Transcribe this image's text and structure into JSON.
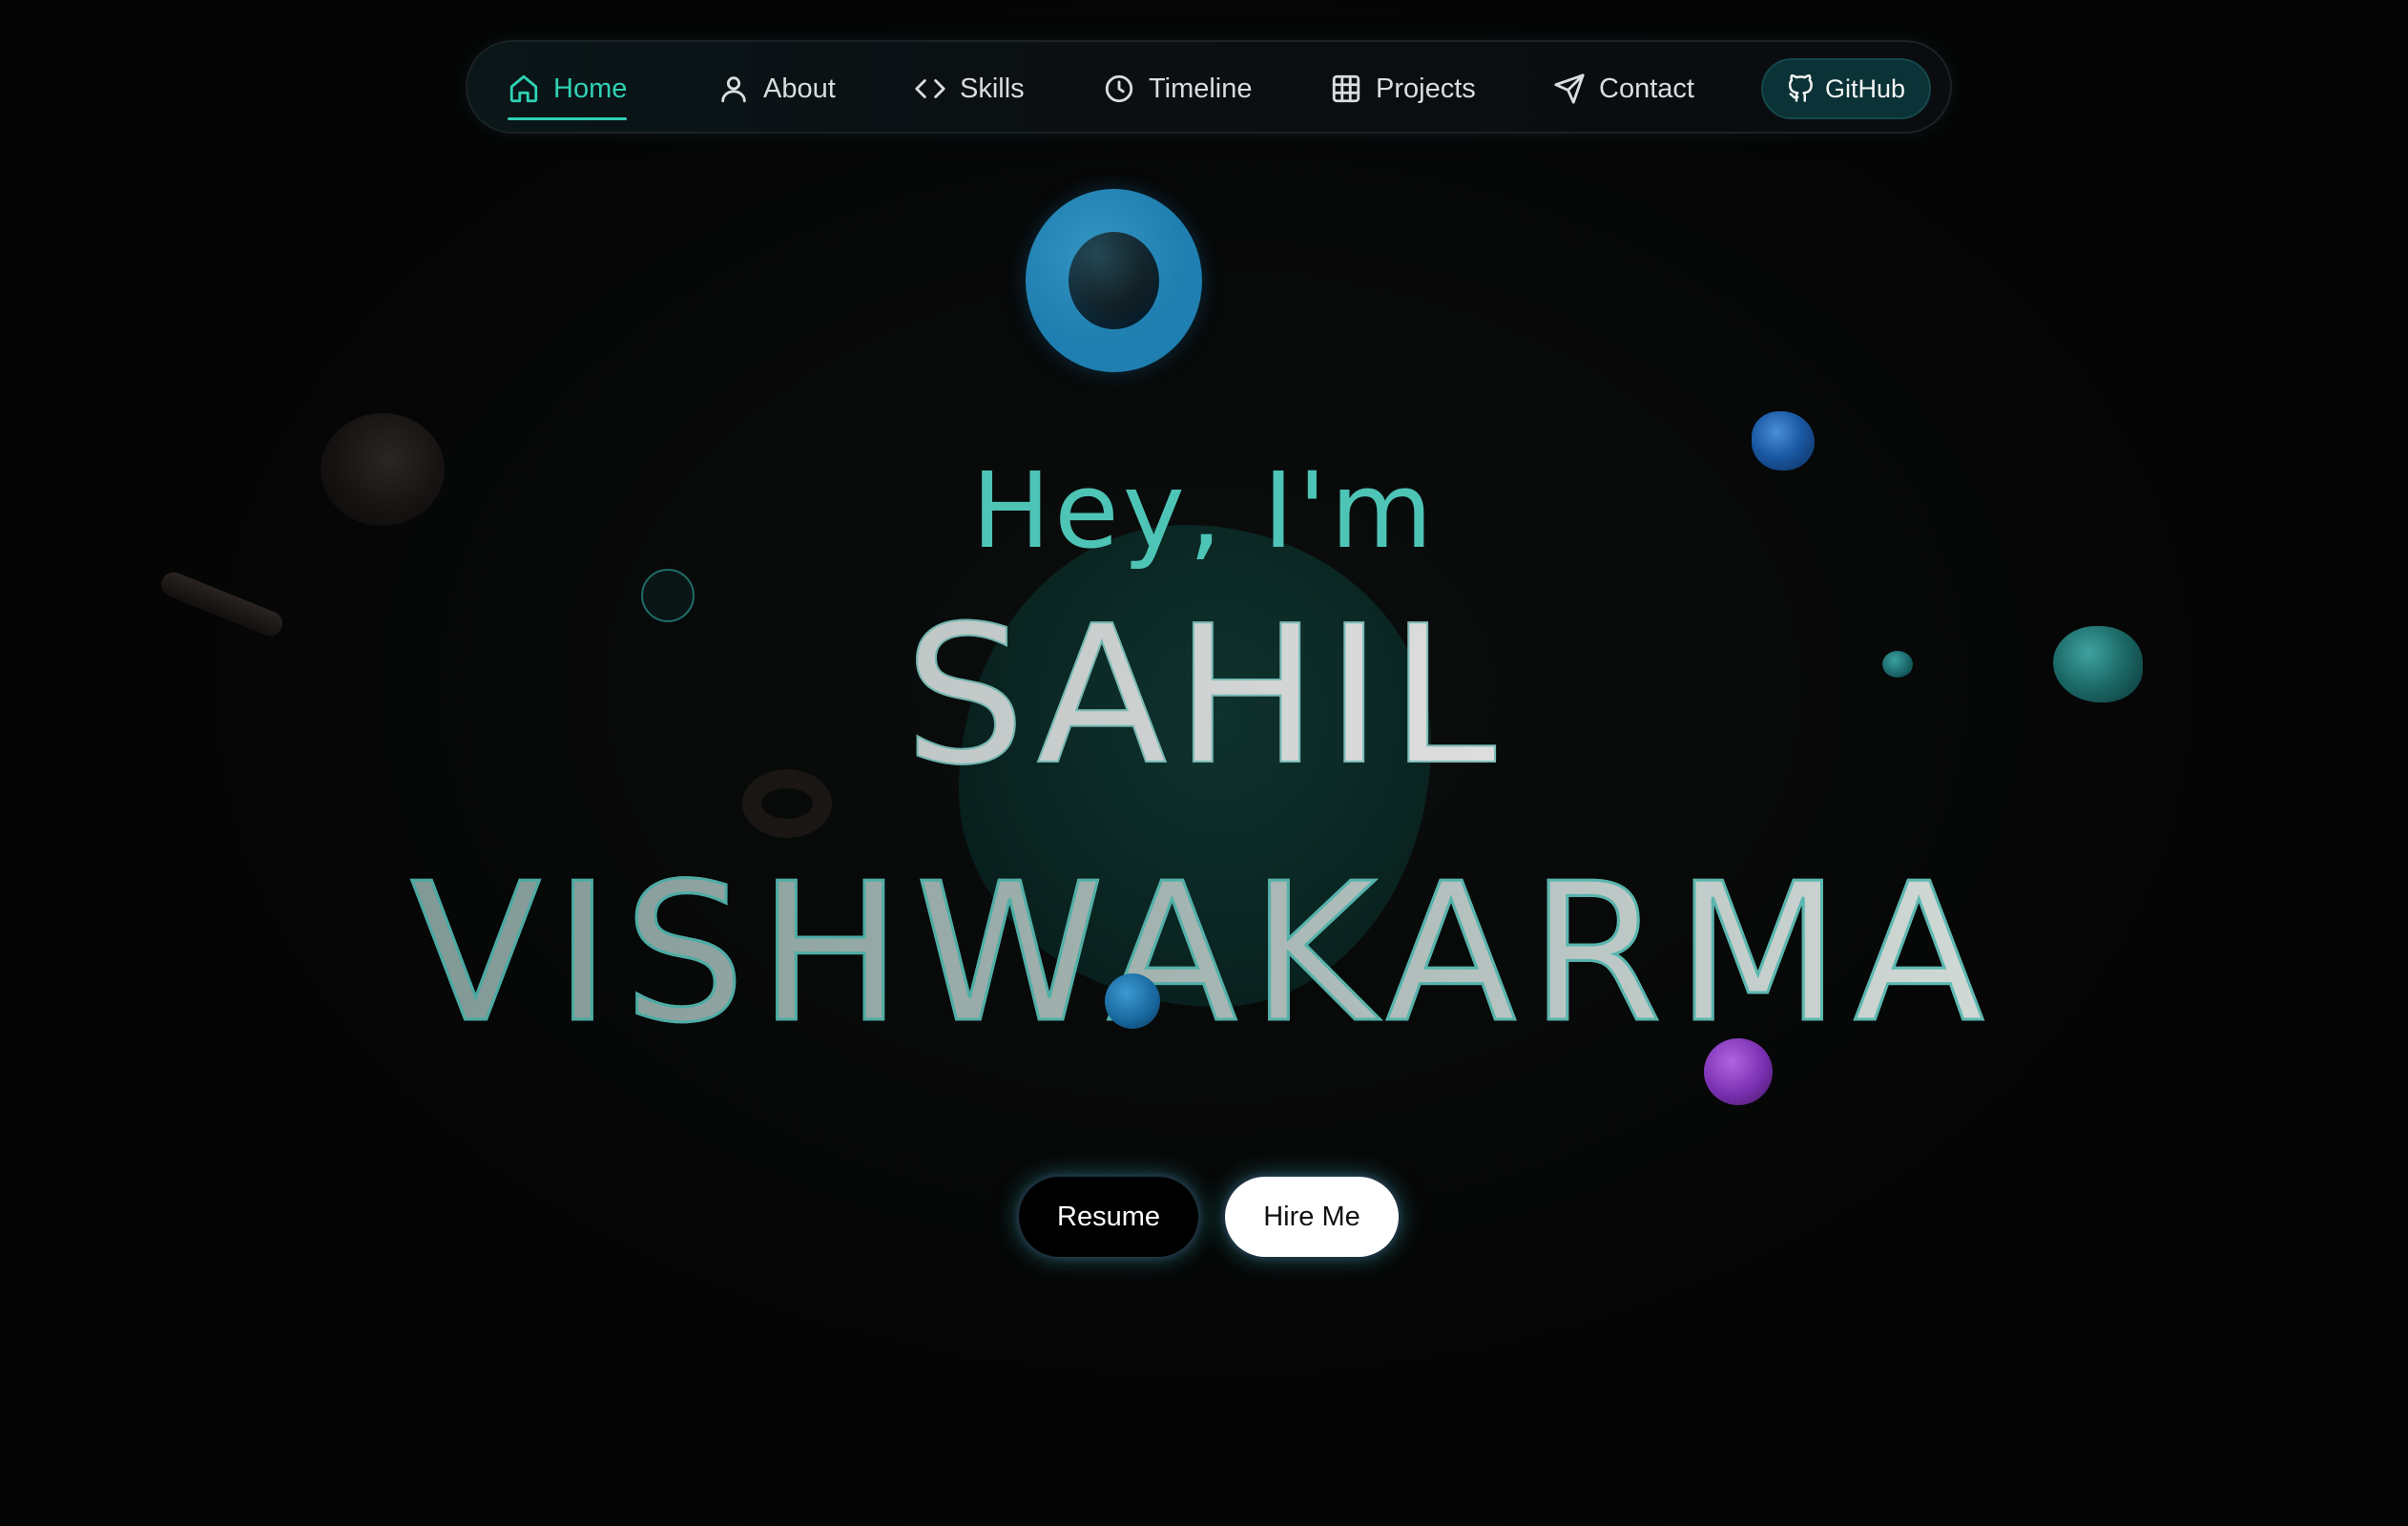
{
  "nav": {
    "items": [
      {
        "label": "Home",
        "icon": "home-icon",
        "active": true
      },
      {
        "label": "About",
        "icon": "user-icon",
        "active": false
      },
      {
        "label": "Skills",
        "icon": "code-icon",
        "active": false
      },
      {
        "label": "Timeline",
        "icon": "clock-icon",
        "active": false
      },
      {
        "label": "Projects",
        "icon": "grid-icon",
        "active": false
      },
      {
        "label": "Contact",
        "icon": "send-icon",
        "active": false
      }
    ],
    "github_label": "GitHub",
    "github_icon": "github-icon"
  },
  "hero": {
    "greeting": "Hey, I'm",
    "first_name": "SAHIL",
    "last_name": "VISHWAKARMA"
  },
  "cta": {
    "resume_label": "Resume",
    "hire_label": "Hire Me"
  },
  "colors": {
    "accent": "#2fd1b4",
    "background": "#050505",
    "github_button_bg": "#0b3236"
  }
}
